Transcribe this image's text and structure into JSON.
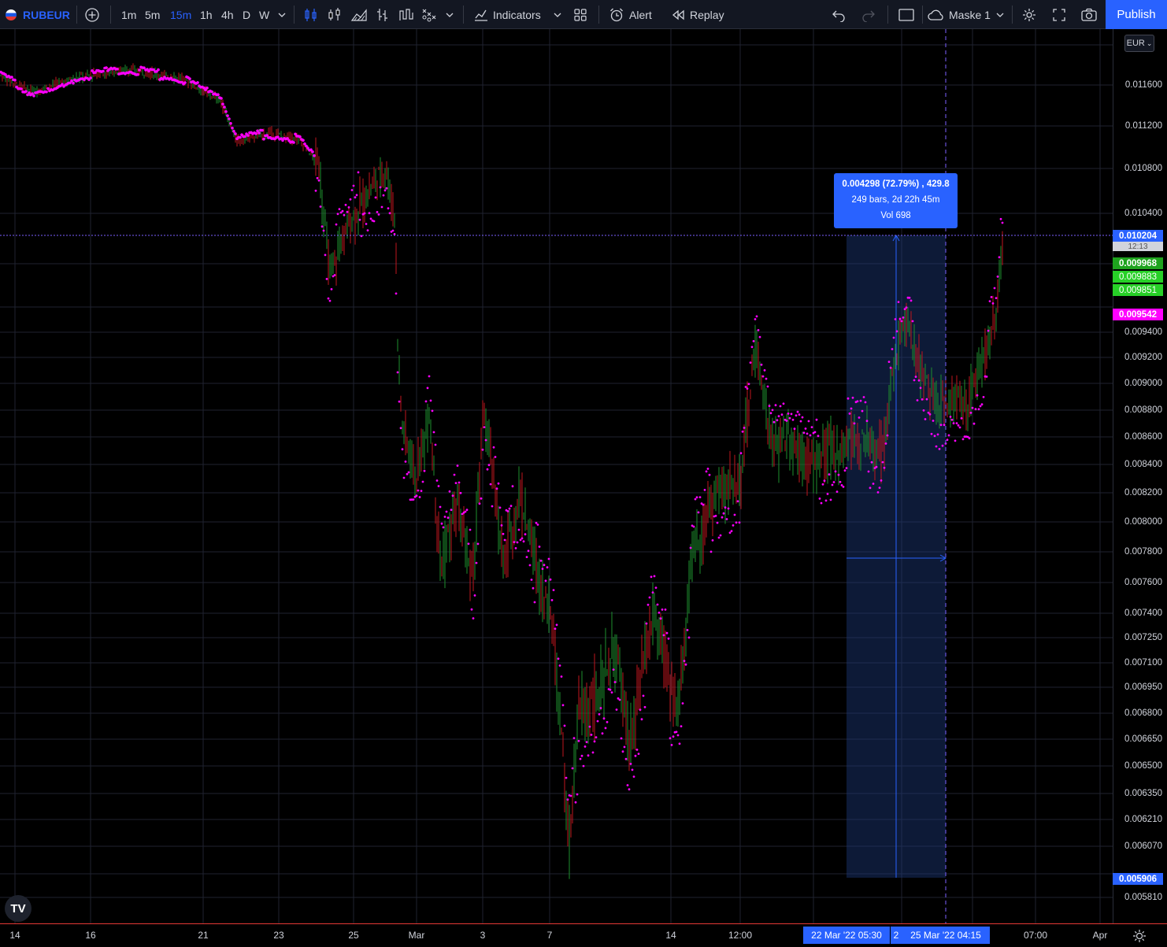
{
  "toolbar": {
    "symbol": "RUBEUR",
    "timeframes": [
      "1m",
      "5m",
      "15m",
      "1h",
      "4h",
      "D",
      "W"
    ],
    "active_timeframe": "15m",
    "indicators_label": "Indicators",
    "alert_label": "Alert",
    "replay_label": "Replay",
    "layout_label": "Maske 1",
    "publish_label": "Publish"
  },
  "price_axis": {
    "currency": "EUR",
    "labels": [
      "0.011600",
      "0.011200",
      "0.010800",
      "0.010400",
      "0.009400",
      "0.009200",
      "0.009000",
      "0.008800",
      "0.008600",
      "0.008400",
      "0.008200",
      "0.008000",
      "0.007800",
      "0.007600",
      "0.007400",
      "0.007250",
      "0.007100",
      "0.006950",
      "0.006800",
      "0.006650",
      "0.006500",
      "0.006350",
      "0.006210",
      "0.006070",
      "0.005810"
    ],
    "tags": {
      "crosshair_price": "0.010204",
      "countdown": "12:13",
      "last_price": "0.009968",
      "bid": "0.009883",
      "ask": "0.009851",
      "indicator_value": "0.009542",
      "range_low": "0.005906"
    }
  },
  "time_axis": {
    "labels": [
      "14",
      "16",
      "21",
      "23",
      "25",
      "Mar",
      "3",
      "7",
      "14",
      "12:00",
      "07:00",
      "Apr"
    ],
    "range_start": "22 Mar '22   05:30",
    "range_end": "25 Mar '22   04:15",
    "range_start_short": "2"
  },
  "measure_tooltip": {
    "line1": "0.004298 (72.79%) , 429.8",
    "line2": "249 bars, 2d 22h 45m",
    "line3": "Vol 698"
  },
  "colors": {
    "accent": "#2962ff",
    "up": "#1e8f2e",
    "down": "#c0161e",
    "psar": "#ff00ff",
    "last_price": "#1ea31e",
    "bid_ask": "#27d027",
    "background": "#000000",
    "toolbar": "#131722"
  },
  "chart_data": {
    "type": "line",
    "series": [
      {
        "values_approx_path": [
          [
            0,
            0.0117
          ],
          [
            40,
            0.01153
          ],
          [
            100,
            0.01168
          ],
          [
            160,
            0.01175
          ],
          [
            230,
            0.01167
          ],
          [
            280,
            0.01145
          ],
          [
            300,
            0.01106
          ],
          [
            340,
            0.01113
          ],
          [
            380,
            0.01108
          ],
          [
            405,
            0.01083
          ],
          [
            418,
            0.0099
          ],
          [
            445,
            0.01033
          ],
          [
            490,
            0.01082
          ],
          [
            502,
            0.01032
          ],
          [
            505,
            0.0094
          ],
          [
            510,
            0.0087
          ],
          [
            530,
            0.0083
          ],
          [
            545,
            0.0088
          ],
          [
            560,
            0.0077
          ],
          [
            580,
            0.0081
          ],
          [
            600,
            0.0076
          ],
          [
            615,
            0.0088
          ],
          [
            640,
            0.0077
          ],
          [
            660,
            0.0082
          ],
          [
            690,
            0.0075
          ],
          [
            700,
            0.0074
          ],
          [
            715,
            0.0066
          ],
          [
            722,
            0.006
          ],
          [
            735,
            0.0068
          ],
          [
            760,
            0.0069
          ],
          [
            780,
            0.0072
          ],
          [
            800,
            0.0066
          ],
          [
            830,
            0.0074
          ],
          [
            860,
            0.0068
          ],
          [
            880,
            0.0078
          ],
          [
            910,
            0.0082
          ],
          [
            940,
            0.0083
          ],
          [
            960,
            0.0093
          ],
          [
            980,
            0.0085
          ],
          [
            1000,
            0.0086
          ],
          [
            1030,
            0.0084
          ],
          [
            1060,
            0.0085
          ],
          [
            1090,
            0.0086
          ],
          [
            1120,
            0.0085
          ],
          [
            1140,
            0.0093
          ],
          [
            1150,
            0.00945
          ],
          [
            1170,
            0.0091
          ],
          [
            1190,
            0.0088
          ],
          [
            1210,
            0.0089
          ],
          [
            1230,
            0.00885
          ],
          [
            1250,
            0.0092
          ],
          [
            1265,
            0.0095
          ],
          [
            1272,
            0.01015
          ],
          [
            1275,
            0.00997
          ]
        ]
      }
    ],
    "measure": {
      "from": 0.005906,
      "to": 0.010204,
      "change": 0.004298,
      "change_pct": 72.79,
      "bars": 249
    }
  }
}
